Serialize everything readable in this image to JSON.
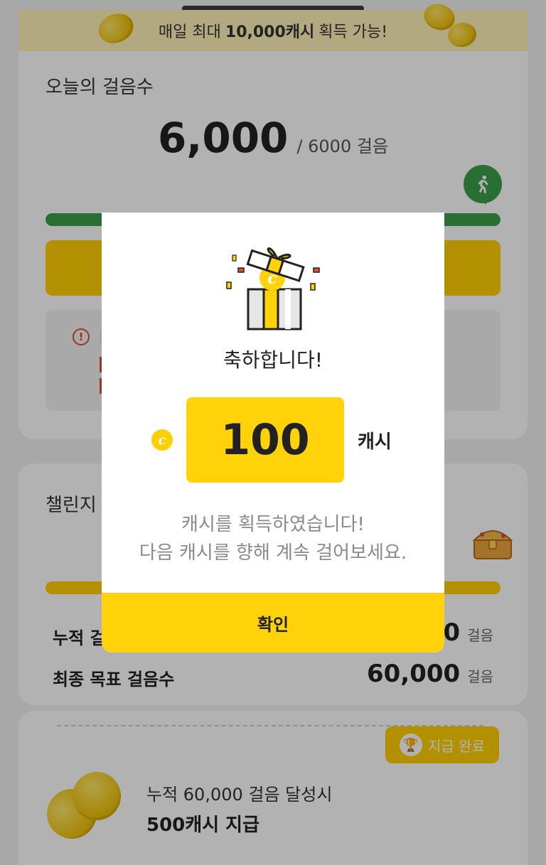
{
  "banner": {
    "prefix": "매일 최대",
    "highlight": "10,000캐시",
    "suffix": "획득 가능!"
  },
  "today": {
    "label": "오늘의 걸음수",
    "steps": "6,000",
    "goal": "/ 6000",
    "unit": "걸음",
    "progress_fraction": 1.0
  },
  "challenge": {
    "title_partial": "챌린지",
    "rows": [
      {
        "label": "누적 걸",
        "value": "0",
        "unit": "걸음"
      },
      {
        "label": "최종 목표 걸음수",
        "value": "60,000",
        "unit": "걸음"
      }
    ]
  },
  "reward": {
    "badge": "지급 완료",
    "line1": "누적 60,000 걸음 달성시",
    "line2": "500캐시 지급"
  },
  "modal": {
    "title": "축하합니다!",
    "amount": "100",
    "amount_unit": "캐시",
    "coin_glyph": "c",
    "message_line1": "캐시를 획득하였습니다!",
    "message_line2": "다음 캐시를 향해 계속 걸어보세요.",
    "confirm_label": "확인"
  },
  "colors": {
    "accent_yellow": "#ffd20a",
    "progress_green": "#3aa04a",
    "warning_red": "#e14b3a"
  }
}
